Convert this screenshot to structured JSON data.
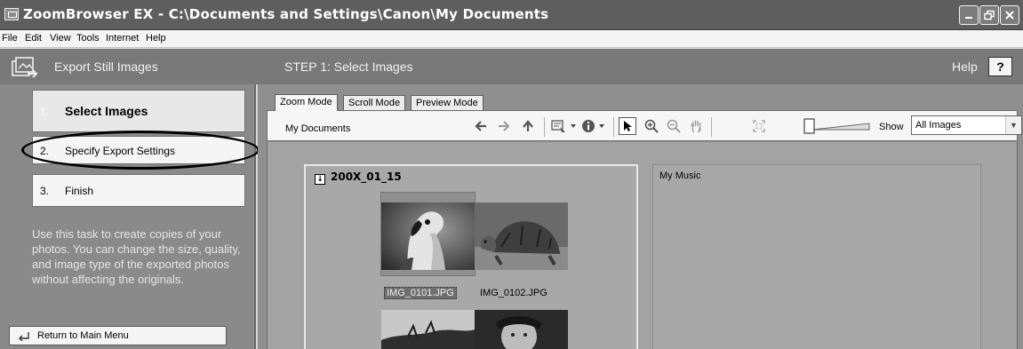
{
  "window": {
    "title": "ZoomBrowser EX  -  C:\\Documents and Settings\\Canon\\My Documents",
    "controls": [
      "minimize-icon",
      "restore-icon",
      "close-icon"
    ]
  },
  "menu": [
    "File",
    "Edit",
    "View",
    "Tools",
    "Internet",
    "Help"
  ],
  "task_header": {
    "task_title": "Export Still Images",
    "step_title": "STEP 1: Select Images",
    "help_label": "Help",
    "help_button": "?"
  },
  "steps": [
    {
      "number": "1.",
      "label": "Select Images",
      "active": true
    },
    {
      "number": "2.",
      "label": "Specify Export Settings",
      "active": false
    },
    {
      "number": "3.",
      "label": "Finish",
      "active": false
    }
  ],
  "description": "Use this task to create copies of your photos. You can change the size, quality, and image type of the exported photos without affecting the originals.",
  "return_button": "Return to Main Menu",
  "tabs": [
    {
      "label": "Zoom Mode",
      "active": true
    },
    {
      "label": "Scroll Mode",
      "active": false
    },
    {
      "label": "Preview Mode",
      "active": false
    }
  ],
  "toolbar": {
    "breadcrumb": "My Documents",
    "show_label": "Show",
    "show_value": "All Images",
    "icons": [
      "back-arrow-icon",
      "forward-arrow-icon",
      "up-folder-icon",
      "select-images-icon",
      "info-icon",
      "pointer-icon",
      "zoom-in-icon",
      "zoom-out-icon",
      "hand-icon",
      "fit-icon"
    ]
  },
  "folders": [
    {
      "name": "200X_01_15",
      "images": [
        {
          "filename": "IMG_0101.JPG",
          "selected": true
        },
        {
          "filename": "IMG_0102.JPG",
          "selected": false
        }
      ]
    },
    {
      "name": "My Music"
    }
  ]
}
